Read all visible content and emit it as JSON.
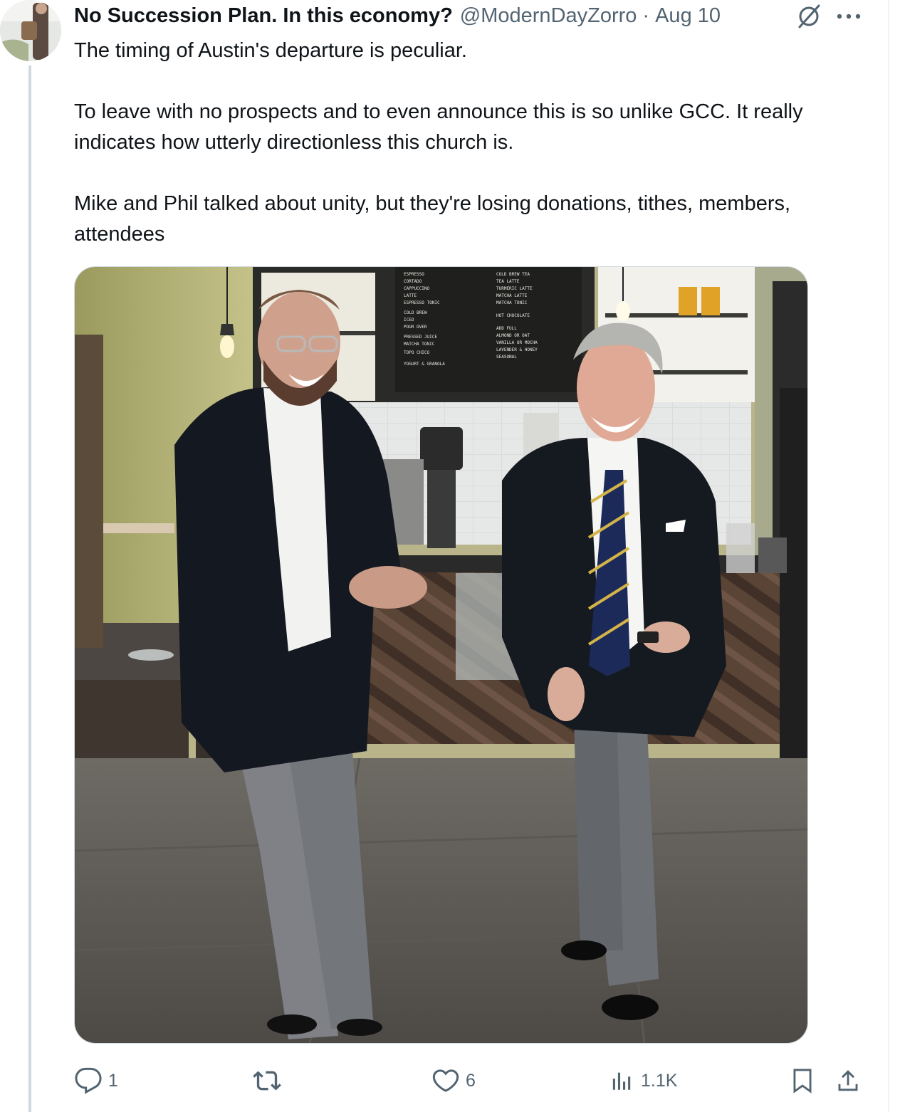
{
  "tweet": {
    "display_name": "No Succession Plan. In this economy?",
    "handle": "@ModernDayZorro",
    "separator": "·",
    "date": "Aug 10",
    "paragraphs": [
      "The timing of Austin's departure is peculiar.",
      "To leave with no prospects and to even announce this is so unlike GCC.  It really indicates how utterly directionless this church is.",
      "Mike and Phil talked about unity, but they're losing donations, tithes, members, attendees"
    ]
  },
  "media": {
    "menu_board_left": [
      "ESPRESSO",
      "CORTADO",
      "CAPPUCCINO",
      "LATTE",
      "ESPRESSO TONIC",
      "COLD BREW",
      "ICED",
      "POUR OVER",
      "PRESSED JUICE",
      "MATCHA TONIC",
      "TOPO CHICO",
      "YOGURT & GRANOLA"
    ],
    "menu_board_right": [
      "COLD BREW TEA",
      "TEA LATTE",
      "TURMERIC LATTE",
      "MATCHA LATTE",
      "MATCHA TONIC",
      "HOT CHOCOLATE",
      "ADD FULL",
      "ALMOND OR OAT",
      "VANILLA OR MOCHA",
      "LAVENDER & HONEY",
      "SEASONAL"
    ]
  },
  "actions": {
    "reply_count": "1",
    "retweet_count": "",
    "like_count": "6",
    "views_count": "1.1K"
  },
  "icons": {
    "reply": "reply-icon",
    "retweet": "retweet-icon",
    "like": "heart-icon",
    "views": "views-icon",
    "bookmark": "bookmark-icon",
    "share": "share-icon",
    "grok": "grok-icon",
    "more": "more-icon"
  },
  "colors": {
    "text_primary": "#0f1419",
    "text_secondary": "#536471",
    "thread_line": "#cfd9de"
  }
}
